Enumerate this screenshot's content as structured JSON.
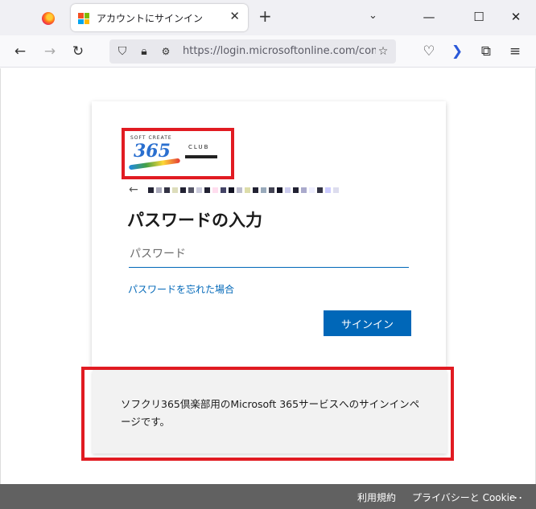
{
  "browser": {
    "tab_title": "アカウントにサインイン",
    "new_tab_label": "+",
    "url": "https://login.microsoftonline.com/com"
  },
  "icons": {
    "back": "back-arrow-icon",
    "forward": "forward-arrow-icon",
    "reload": "reload-icon",
    "shield": "shield-icon",
    "lock": "lock-icon",
    "permissions": "permissions-icon",
    "bookmark": "star-icon",
    "pocket": "pocket-icon",
    "extension": "extension-icon",
    "menu": "hamburger-menu-icon"
  },
  "signin": {
    "logo": {
      "top_text": "SOFT CREATE",
      "number": "365",
      "club": "CLUB"
    },
    "heading": "パスワードの入力",
    "password_placeholder": "パスワード",
    "forgot_link": "パスワードを忘れた場合",
    "signin_button": "サインイン",
    "footer_text": "ソフクリ365倶楽部用のMicrosoft 365サービスへのサインインページです。"
  },
  "footer_bar": {
    "terms": "利用規約",
    "privacy": "プライバシーと Cookie",
    "more": "..."
  },
  "colors": {
    "accent": "#0067b8",
    "highlight_border": "#e11b22",
    "bottom_bar": "#616161"
  }
}
